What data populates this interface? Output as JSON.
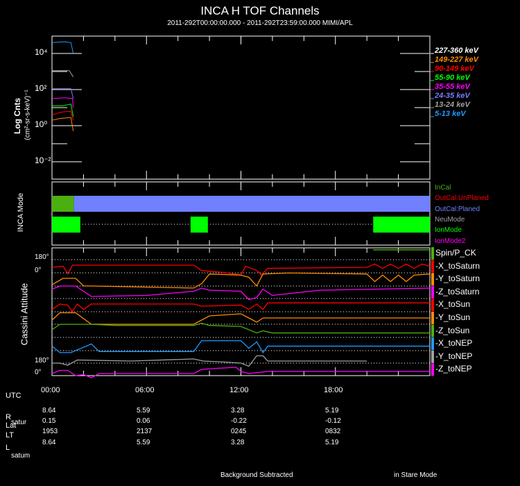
{
  "title": "INCA H TOF Channels",
  "subtitle": "2011-292T00:00:00.000 - 2011-292T23:59:00.000 MIMI/APL",
  "chart_data": [
    {
      "type": "line",
      "title": "INCA H TOF Channels",
      "ylabel": "Log Cnts",
      "ylabel2": "(cm²-sr-s-keV)⁻¹",
      "yscale": "log",
      "ylim_log10": [
        -3,
        5
      ],
      "yticks": [
        {
          "label": "10⁴",
          "exp": 4
        },
        {
          "label": "10²",
          "exp": 2
        },
        {
          "label": "10⁰",
          "exp": 0
        },
        {
          "label": "10⁻²",
          "exp": -2
        }
      ],
      "xlim_hours": [
        0,
        24
      ],
      "series": [
        {
          "name": "227-360 keV",
          "color": "#ffffff",
          "log_values": [
            [
              0,
              0
            ],
            [
              1.3,
              0
            ]
          ]
        },
        {
          "name": "149-227 keV",
          "color": "#ff8c00",
          "log_values": [
            [
              0,
              0.3
            ],
            [
              0.5,
              0.4
            ],
            [
              1.2,
              0.45
            ],
            [
              1.35,
              -0.3
            ]
          ]
        },
        {
          "name": "90-149 keV",
          "color": "#ff0000",
          "log_values": [
            [
              0,
              0.6
            ],
            [
              0.6,
              0.75
            ],
            [
              1.2,
              0.8
            ],
            [
              1.35,
              0.3
            ]
          ]
        },
        {
          "name": "55-90 keV",
          "color": "#00ff00",
          "log_values": [
            [
              0,
              1.1
            ],
            [
              0.7,
              1.1
            ],
            [
              1.2,
              1.2
            ],
            [
              1.35,
              0.5
            ]
          ]
        },
        {
          "name": "35-55 keV",
          "color": "#ff00ff",
          "log_values": [
            [
              0,
              1.5
            ],
            [
              0.8,
              1.55
            ],
            [
              1.3,
              1.5
            ],
            [
              1.35,
              1.0
            ]
          ]
        },
        {
          "name": "24-35 keV",
          "color": "#7b7bff",
          "log_values": [
            [
              0,
              2.05
            ],
            [
              1.2,
              2.05
            ],
            [
              1.35,
              1.5
            ]
          ]
        },
        {
          "name": "13-24 keV",
          "color": "#a0a0a0",
          "log_values": [
            [
              0,
              3.05
            ],
            [
              1.1,
              3.05
            ],
            [
              1.35,
              2.7
            ]
          ]
        },
        {
          "name": "5-13 keV",
          "color": "#1e9bff",
          "log_values": [
            [
              0,
              4.6
            ],
            [
              0.8,
              4.65
            ],
            [
              1.2,
              4.6
            ],
            [
              1.35,
              4.0
            ]
          ]
        }
      ]
    },
    {
      "type": "timeline",
      "ylabel": "INCA Mode",
      "legend": [
        {
          "name": "InCal",
          "color": "#4caf10"
        },
        {
          "name": "OutCal:UnPlaned",
          "color": "#ff0000"
        },
        {
          "name": "OutCal:Planed",
          "color": "#7080ff"
        },
        {
          "name": "NeuMode",
          "color": "#a0a0a0"
        },
        {
          "name": "IonMode",
          "color": "#00ff00"
        },
        {
          "name": "IonMode2",
          "color": "#ff00ff"
        }
      ],
      "cal_intervals": [
        {
          "state": "InCal",
          "start": 0,
          "end": 1.4
        },
        {
          "state": "OutCal:Planed",
          "start": 1.4,
          "end": 24
        }
      ],
      "ion_intervals": [
        [
          0,
          1.8
        ],
        [
          8.8,
          9.9
        ],
        [
          20.4,
          24
        ]
      ]
    },
    {
      "type": "line",
      "ylabel": "Cassini Attitude",
      "ytick_labels": [
        "180°",
        "0°",
        "180°",
        "0°"
      ],
      "series": [
        {
          "name": "Spin/P_CK",
          "color": "#4caf10",
          "values": [
            [
              20.4,
              150
            ],
            [
              24,
              150
            ]
          ]
        },
        {
          "name": "-X_toSaturn",
          "color": "#ff0000",
          "values": [
            [
              0,
              90
            ],
            [
              0.7,
              100
            ],
            [
              1.0,
              30
            ],
            [
              1.3,
              110
            ],
            [
              4,
              110
            ],
            [
              9,
              110
            ],
            [
              9.5,
              60
            ],
            [
              11,
              40
            ],
            [
              12,
              20
            ],
            [
              12.3,
              100
            ],
            [
              13,
              60
            ],
            [
              13.3,
              20
            ],
            [
              13.7,
              80
            ],
            [
              20,
              90
            ],
            [
              20.5,
              120
            ],
            [
              21,
              80
            ],
            [
              21.5,
              120
            ],
            [
              22,
              80
            ],
            [
              22.5,
              120
            ],
            [
              23,
              80
            ],
            [
              23.5,
              120
            ],
            [
              24,
              100
            ]
          ]
        },
        {
          "name": "-Y_toSaturn",
          "color": "#ff8c00",
          "values": [
            [
              0,
              50
            ],
            [
              0.7,
              110
            ],
            [
              1.5,
              110
            ],
            [
              2,
              40
            ],
            [
              9,
              20
            ],
            [
              9.5,
              60
            ],
            [
              10,
              150
            ],
            [
              12,
              140
            ],
            [
              12.5,
              120
            ],
            [
              13,
              40
            ],
            [
              13.4,
              150
            ],
            [
              15,
              160
            ],
            [
              20,
              150
            ],
            [
              20.5,
              80
            ],
            [
              21,
              140
            ],
            [
              21.5,
              80
            ],
            [
              22,
              140
            ],
            [
              22.5,
              80
            ],
            [
              23,
              140
            ],
            [
              24,
              150
            ]
          ]
        },
        {
          "name": "-Z_toSaturn",
          "color": "#ff00ff",
          "values": [
            [
              0,
              130
            ],
            [
              0.5,
              160
            ],
            [
              1.5,
              160
            ],
            [
              2.5,
              60
            ],
            [
              6,
              70
            ],
            [
              9,
              110
            ],
            [
              9.5,
              140
            ],
            [
              10,
              120
            ],
            [
              12,
              110
            ],
            [
              12.5,
              30
            ],
            [
              13,
              50
            ],
            [
              13.4,
              130
            ],
            [
              14,
              70
            ],
            [
              17,
              120
            ],
            [
              24,
              140
            ]
          ]
        },
        {
          "name": "-X_toSun",
          "color": "#ff0000",
          "values": [
            [
              0,
              60
            ],
            [
              0.5,
              110
            ],
            [
              1,
              100
            ],
            [
              1.3,
              40
            ],
            [
              1.6,
              110
            ],
            [
              2,
              60
            ],
            [
              2.5,
              110
            ],
            [
              9,
              110
            ],
            [
              9.5,
              90
            ],
            [
              12,
              100
            ],
            [
              12.5,
              60
            ],
            [
              13,
              110
            ],
            [
              13.4,
              60
            ],
            [
              13.7,
              120
            ],
            [
              24,
              120
            ]
          ]
        },
        {
          "name": "-Y_toSun",
          "color": "#ff8c00",
          "values": [
            [
              0,
              80
            ],
            [
              0.5,
              150
            ],
            [
              1.5,
              150
            ],
            [
              2.5,
              40
            ],
            [
              9,
              40
            ],
            [
              9.5,
              80
            ],
            [
              10,
              120
            ],
            [
              12,
              140
            ],
            [
              12.5,
              100
            ],
            [
              13,
              60
            ],
            [
              13.4,
              100
            ],
            [
              24,
              100
            ]
          ]
        },
        {
          "name": "-Z_toSun",
          "color": "#4caf10",
          "values": [
            [
              0,
              110
            ],
            [
              0.5,
              160
            ],
            [
              2.5,
              160
            ],
            [
              4,
              150
            ],
            [
              9,
              150
            ],
            [
              9.5,
              170
            ],
            [
              10,
              150
            ],
            [
              12,
              140
            ],
            [
              12.5,
              110
            ],
            [
              13,
              80
            ],
            [
              13.4,
              100
            ],
            [
              14,
              80
            ],
            [
              24,
              80
            ]
          ]
        },
        {
          "name": "-X_toNEP",
          "color": "#1e9bff",
          "values": [
            [
              0,
              80
            ],
            [
              0.5,
              20
            ],
            [
              1.2,
              20
            ],
            [
              2.5,
              100
            ],
            [
              3,
              30
            ],
            [
              9,
              30
            ],
            [
              9.5,
              130
            ],
            [
              12,
              130
            ],
            [
              12.5,
              60
            ],
            [
              13,
              120
            ],
            [
              13.4,
              20
            ],
            [
              13.7,
              80
            ],
            [
              24,
              80
            ]
          ]
        },
        {
          "name": "-Y_toNEP",
          "color": "#a0a0a0",
          "values": [
            [
              0,
              40
            ],
            [
              0.5,
              40
            ],
            [
              1,
              20
            ],
            [
              1.6,
              70
            ],
            [
              5,
              60
            ],
            [
              9,
              80
            ],
            [
              9.6,
              60
            ],
            [
              11,
              50
            ],
            [
              12,
              40
            ],
            [
              12.5,
              10
            ],
            [
              13,
              110
            ],
            [
              13.4,
              110
            ],
            [
              13.7,
              60
            ],
            [
              20,
              60
            ]
          ]
        },
        {
          "name": "-Z_toNEP",
          "color": "#ff00ff",
          "values": [
            [
              0,
              60
            ],
            [
              0.5,
              90
            ],
            [
              1,
              90
            ],
            [
              1.5,
              40
            ],
            [
              2,
              50
            ],
            [
              2.5,
              20
            ],
            [
              3,
              60
            ],
            [
              9,
              60
            ],
            [
              9.5,
              100
            ],
            [
              10.5,
              110
            ],
            [
              11.7,
              120
            ],
            [
              12,
              80
            ],
            [
              12.5,
              60
            ],
            [
              13.7,
              80
            ],
            [
              24,
              80
            ]
          ]
        }
      ]
    }
  ],
  "time_labels": [
    "00:00",
    "06:00",
    "12:00",
    "18:00"
  ],
  "ephemeris": {
    "utc_label": "UTC",
    "rows": [
      {
        "label": "R",
        "sub": "satur",
        "values": [
          "8.64",
          "5.59",
          "3.28",
          "5.19"
        ]
      },
      {
        "label": "Lat",
        "sub": "",
        "values": [
          "0.15",
          "0.06",
          "-0.22",
          "-0.12"
        ]
      },
      {
        "label": "LT",
        "sub": "",
        "values": [
          "1953",
          "2137",
          "0245",
          "0832"
        ]
      },
      {
        "label": "L",
        "sub": "satum",
        "values": [
          "8.64",
          "5.59",
          "3.28",
          "5.19"
        ]
      }
    ]
  },
  "footer": {
    "left": "Background Subtracted",
    "right": "in Stare Mode"
  }
}
